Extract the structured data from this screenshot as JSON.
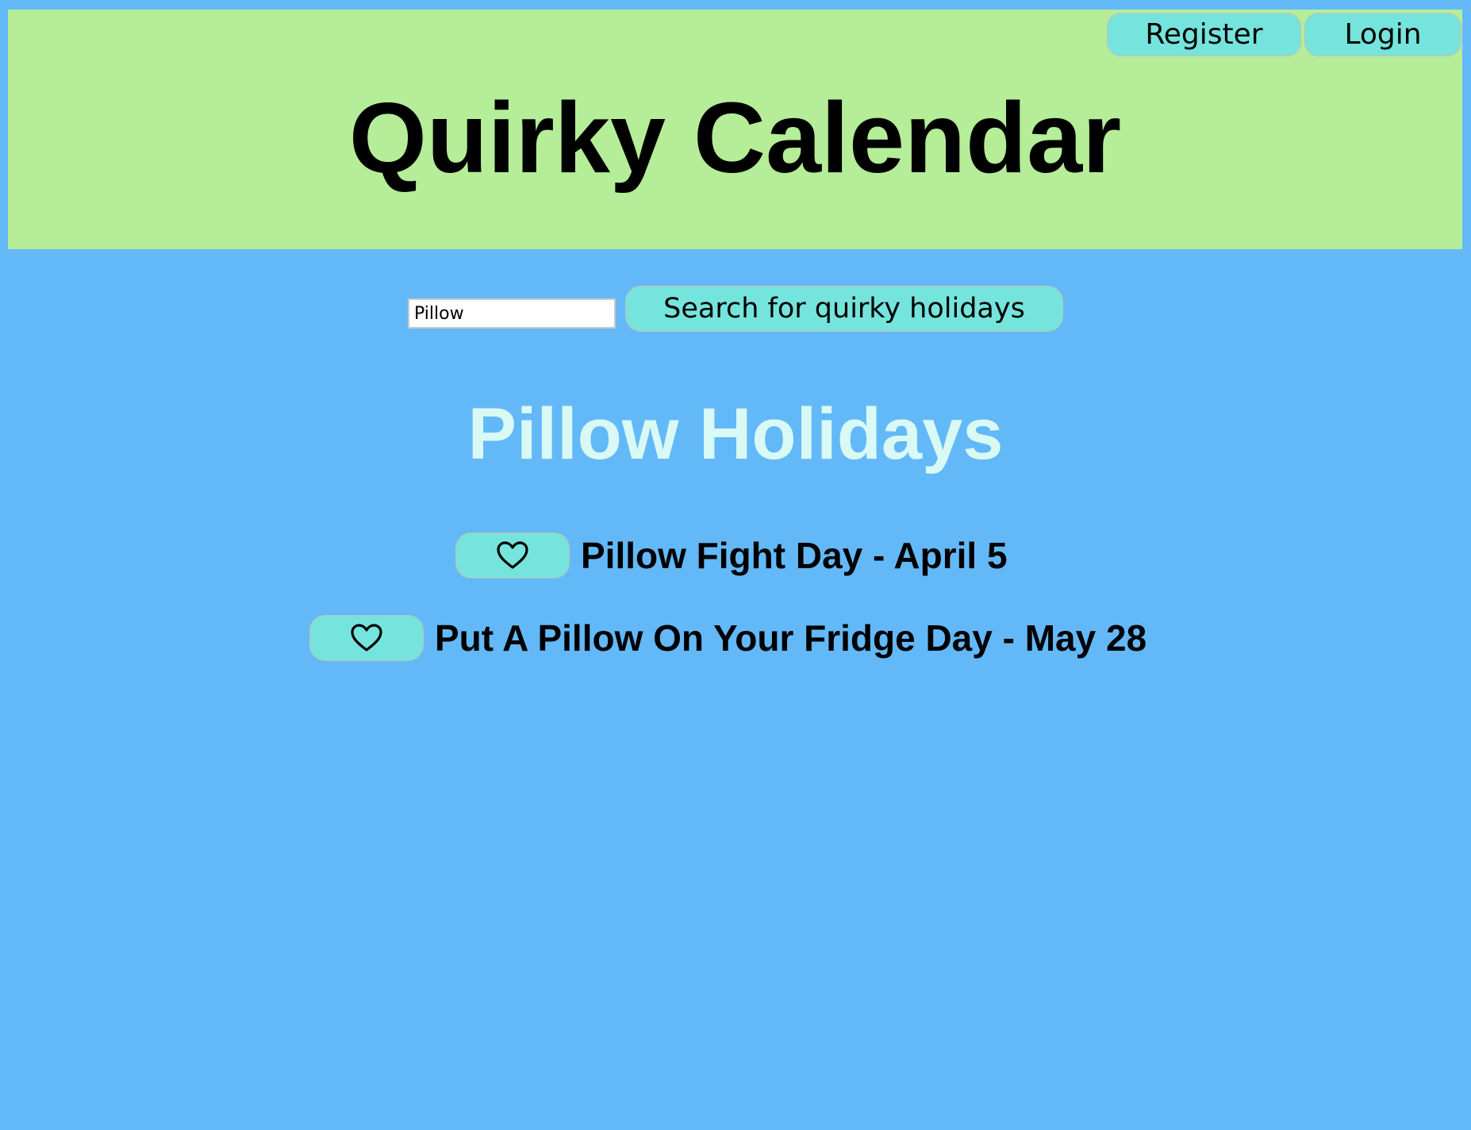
{
  "header": {
    "title": "Quirky Calendar",
    "register_label": "Register",
    "login_label": "Login"
  },
  "search": {
    "value": "Pillow",
    "button_label": "Search for quirky holidays"
  },
  "results": {
    "title": "Pillow Holidays",
    "items": [
      {
        "label": "Pillow Fight Day - April 5",
        "icon": "heart-outline-icon"
      },
      {
        "label": "Put A Pillow On Your Fridge Day - May 28",
        "icon": "heart-outline-icon"
      }
    ]
  },
  "colors": {
    "page_background": "#63b9f8",
    "header_background": "#b5ed98",
    "button_background": "#75e4dc",
    "section_title": "#d9f9f5"
  }
}
